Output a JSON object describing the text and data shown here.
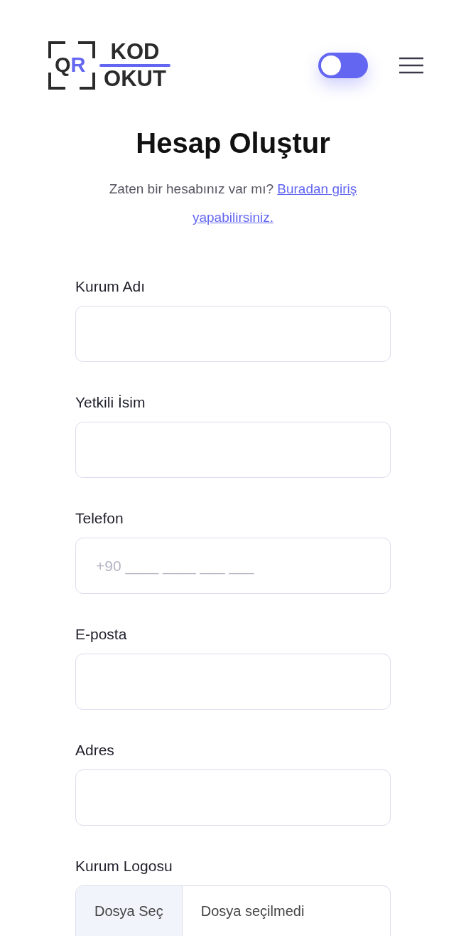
{
  "header": {
    "logo": {
      "q": "Q",
      "r": "R",
      "top": "KOD",
      "bottom": "OKUT"
    },
    "theme_toggle": {
      "on": false
    }
  },
  "title": "Hesap Oluştur",
  "subtitle": {
    "text": "Zaten bir hesabınız var mı?",
    "link_parts": [
      "Buradan giriş",
      "yapabilirsiniz."
    ]
  },
  "fields": [
    {
      "kind": "text",
      "label": "Kurum Adı"
    },
    {
      "kind": "text",
      "label": "Yetkili İsim"
    },
    {
      "kind": "text",
      "label": "Telefon",
      "placeholder": "+90 ____ ____ ___ ___"
    },
    {
      "kind": "text",
      "label": "E-posta"
    },
    {
      "kind": "text",
      "label": "Adres"
    },
    {
      "kind": "file",
      "label": "Kurum Logosu",
      "button": "Dosya Seç",
      "status": "Dosya seçilmedi"
    }
  ]
}
